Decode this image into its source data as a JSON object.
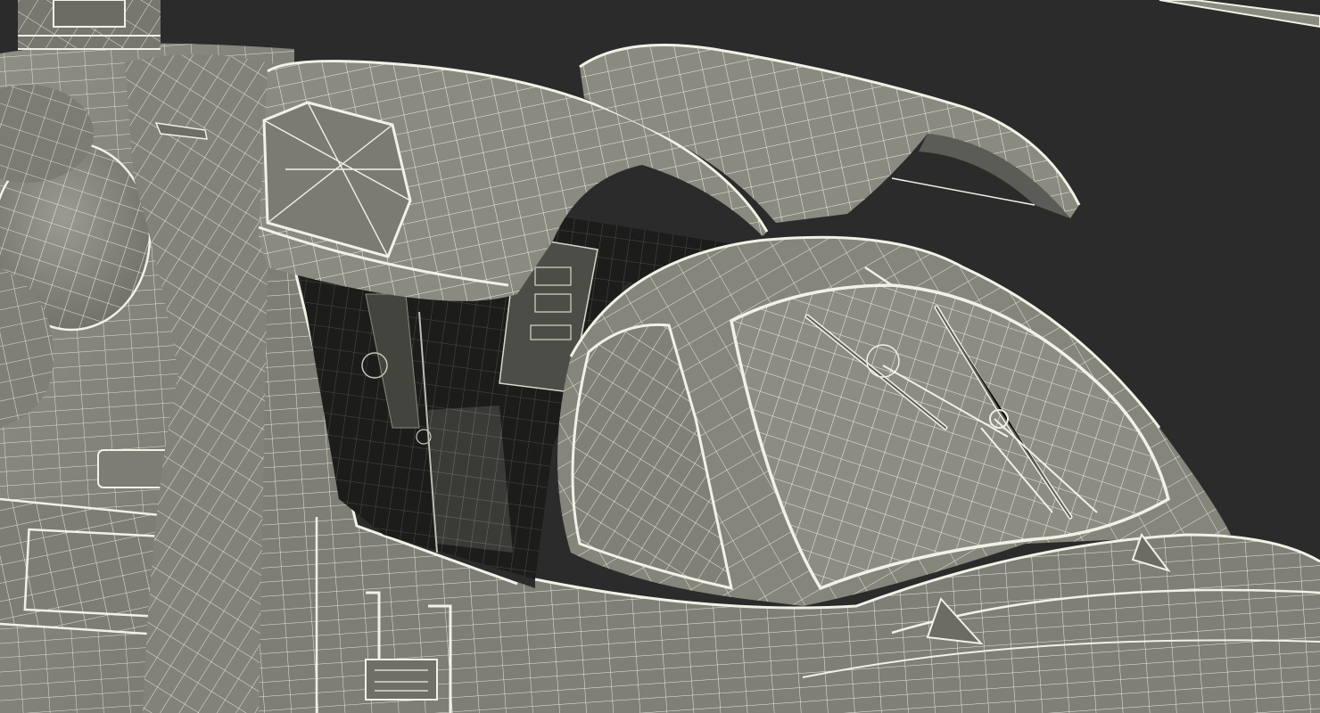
{
  "scene": {
    "subject": "helicopter-cockpit-wireframe",
    "colors": {
      "background": "#2b2b2b",
      "hull": "#85857c",
      "hull_shadow": "#6c6c64",
      "hull_highlight": "#9a9a90",
      "interior": "#1c1c1a",
      "panel": "#5e5e58",
      "wire": "#f1f1e6",
      "wire_soft": "#d8d8cc"
    },
    "icons": {
      "wiper_left": "windshield-wiper-icon",
      "wiper_right": "windshield-wiper-icon",
      "antenna_right": "antenna-fin-icon",
      "antenna_lower": "antenna-fin-icon"
    }
  }
}
